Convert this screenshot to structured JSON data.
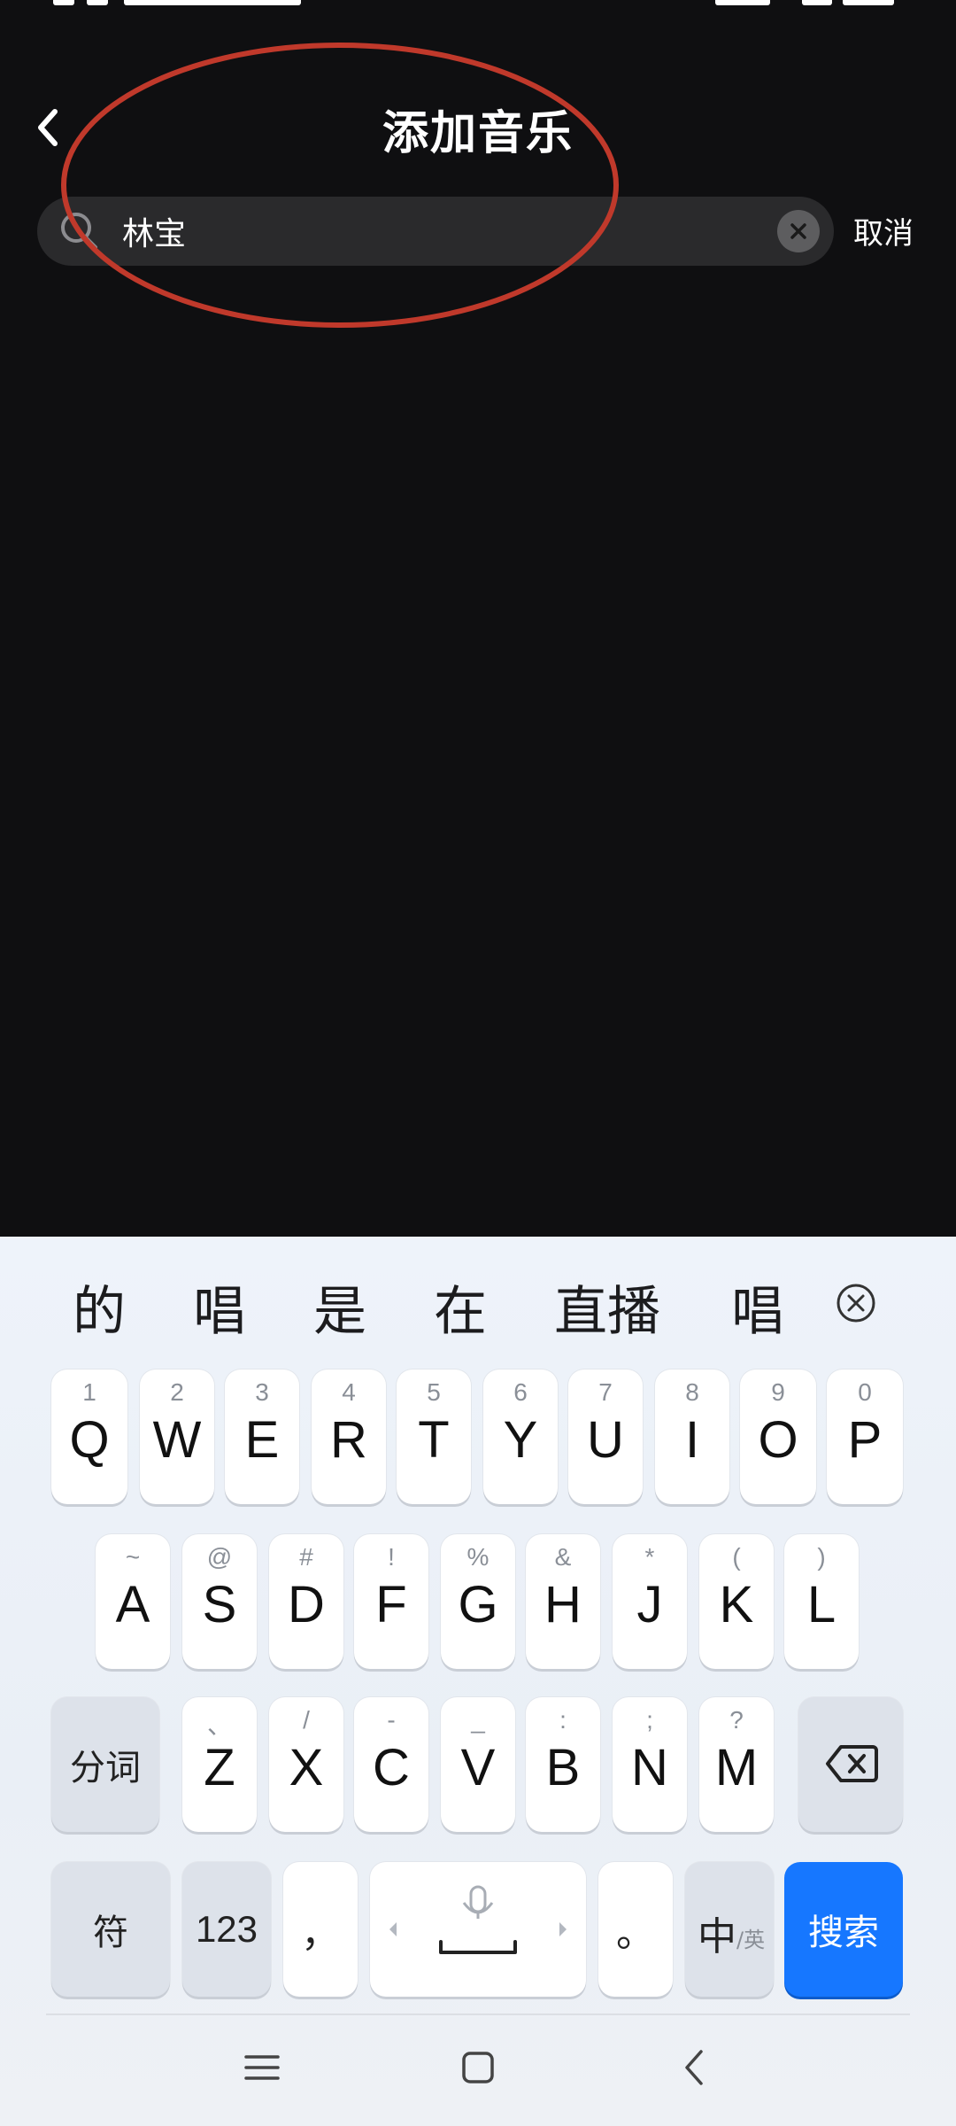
{
  "header": {
    "title": "添加音乐"
  },
  "search": {
    "value": "林宝",
    "cancel_label": "取消"
  },
  "annotation_color": "#c0392b",
  "keyboard": {
    "candidates": [
      "的",
      "唱",
      "是",
      "在",
      "直播",
      "唱"
    ],
    "row1": [
      {
        "key": "Q",
        "sub": "1"
      },
      {
        "key": "W",
        "sub": "2"
      },
      {
        "key": "E",
        "sub": "3"
      },
      {
        "key": "R",
        "sub": "4"
      },
      {
        "key": "T",
        "sub": "5"
      },
      {
        "key": "Y",
        "sub": "6"
      },
      {
        "key": "U",
        "sub": "7"
      },
      {
        "key": "I",
        "sub": "8"
      },
      {
        "key": "O",
        "sub": "9"
      },
      {
        "key": "P",
        "sub": "0"
      }
    ],
    "row2": [
      {
        "key": "A",
        "sub": "~"
      },
      {
        "key": "S",
        "sub": "@"
      },
      {
        "key": "D",
        "sub": "#"
      },
      {
        "key": "F",
        "sub": "!"
      },
      {
        "key": "G",
        "sub": "%"
      },
      {
        "key": "H",
        "sub": "&"
      },
      {
        "key": "J",
        "sub": "*"
      },
      {
        "key": "K",
        "sub": "("
      },
      {
        "key": "L",
        "sub": ")"
      }
    ],
    "row3": [
      {
        "key": "Z",
        "sub": "、"
      },
      {
        "key": "X",
        "sub": "/"
      },
      {
        "key": "C",
        "sub": "-"
      },
      {
        "key": "V",
        "sub": "_"
      },
      {
        "key": "B",
        "sub": ":"
      },
      {
        "key": "N",
        "sub": ";"
      },
      {
        "key": "M",
        "sub": "?"
      }
    ],
    "segment_label": "分词",
    "symbol_label": "符",
    "numbers_label": "123",
    "comma_label": "，",
    "period_label": "。",
    "lang_main": "中",
    "lang_sub": "/英",
    "search_label": "搜索",
    "search_color": "#1677ff"
  }
}
